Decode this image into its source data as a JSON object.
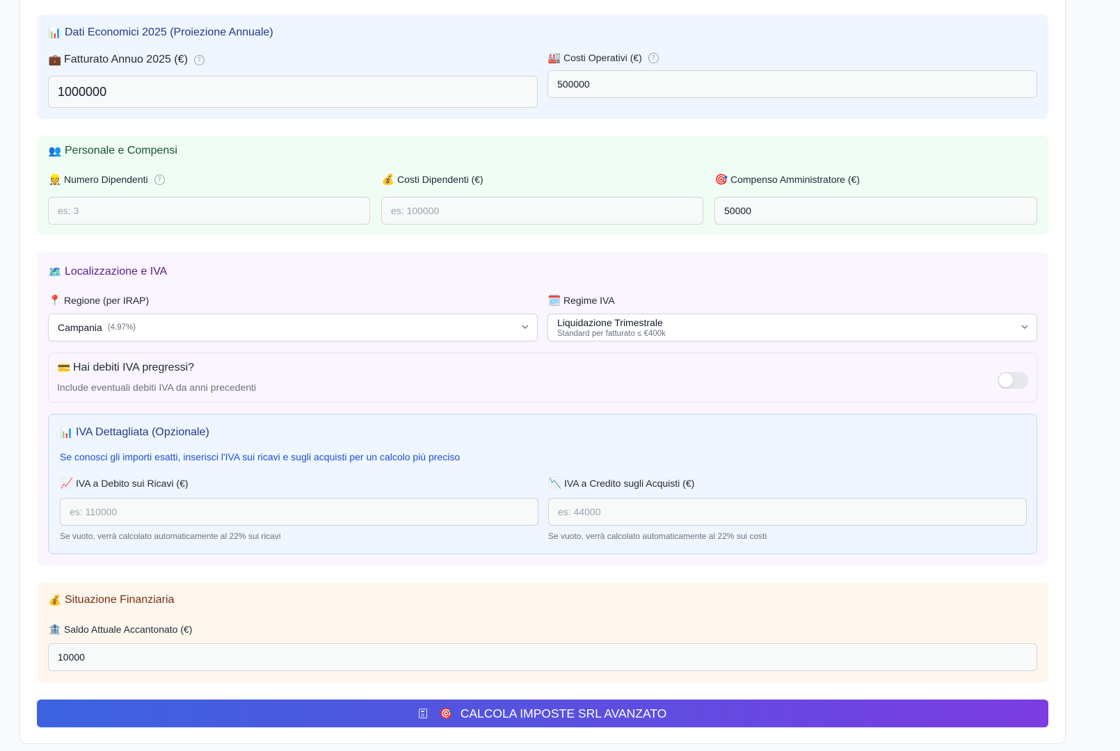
{
  "economic": {
    "title": "Dati Economici 2025 (Proiezione Annuale)",
    "title_icon": "📊",
    "revenue_label": "Fatturato Annuo 2025 (€)",
    "revenue_icon": "💼",
    "revenue_value": "1000000",
    "costs_label": "Costi Operativi (€)",
    "costs_icon": "🏭",
    "costs_value": "500000"
  },
  "staff": {
    "title": "Personale e Compensi",
    "title_icon": "👥",
    "employees_label": "Numero Dipendenti",
    "employees_icon": "👷",
    "employees_placeholder": "es: 3",
    "employee_costs_label": "Costi Dipendenti (€)",
    "employee_costs_icon": "💰",
    "employee_costs_placeholder": "es: 100000",
    "admin_comp_label": "Compenso Amministratore (€)",
    "admin_comp_icon": "🎯",
    "admin_comp_value": "50000"
  },
  "location": {
    "title": "Localizzazione e IVA",
    "title_icon": "🗺️",
    "region_label": "Regione (per IRAP)",
    "region_icon": "📍",
    "region_value": "Campania",
    "region_rate": "(4.97%)",
    "vat_regime_label": "Regime IVA",
    "vat_regime_icon": "🗓️",
    "vat_regime_value": "Liquidazione Trimestrale",
    "vat_regime_sub": "Standard per fatturato ≤ €400k",
    "vat_debt_title": "Hai debiti IVA pregressi?",
    "vat_debt_icon": "💳",
    "vat_debt_desc": "Include eventuali debiti IVA da anni precedenti",
    "vat_debt_enabled": false
  },
  "vat_detail": {
    "title": "IVA Dettagliata (Opzionale)",
    "title_icon": "📊",
    "description": "Se conosci gli importi esatti, inserisci l'IVA sui ricavi e sugli acquisti per un calcolo più preciso",
    "debit_label": "IVA a Debito sui Ricavi (€)",
    "debit_icon": "📈",
    "debit_placeholder": "es: 110000",
    "debit_hint": "Se vuoto, verrà calcolato automaticamente al 22% sui ricavi",
    "credit_label": "IVA a Credito sugli Acquisti (€)",
    "credit_icon": "📉",
    "credit_placeholder": "es: 44000",
    "credit_hint": "Se vuoto, verrà calcolato automaticamente al 22% sui costi"
  },
  "finance": {
    "title": "Situazione Finanziaria",
    "title_icon": "💰",
    "balance_label": "Saldo Attuale Accantonato (€)",
    "balance_icon": "🏦",
    "balance_value": "10000"
  },
  "cta": {
    "icon": "🎯",
    "label": "CALCOLA IMPOSTE SRL AVANZATO"
  },
  "colors": {
    "blue_section": "#eff6ff",
    "green_section": "#f0fdf4",
    "purple_section": "#faf5ff",
    "orange_section": "#fff7ed",
    "cta_start": "#3b63e0",
    "cta_end": "#7c3ce0"
  }
}
